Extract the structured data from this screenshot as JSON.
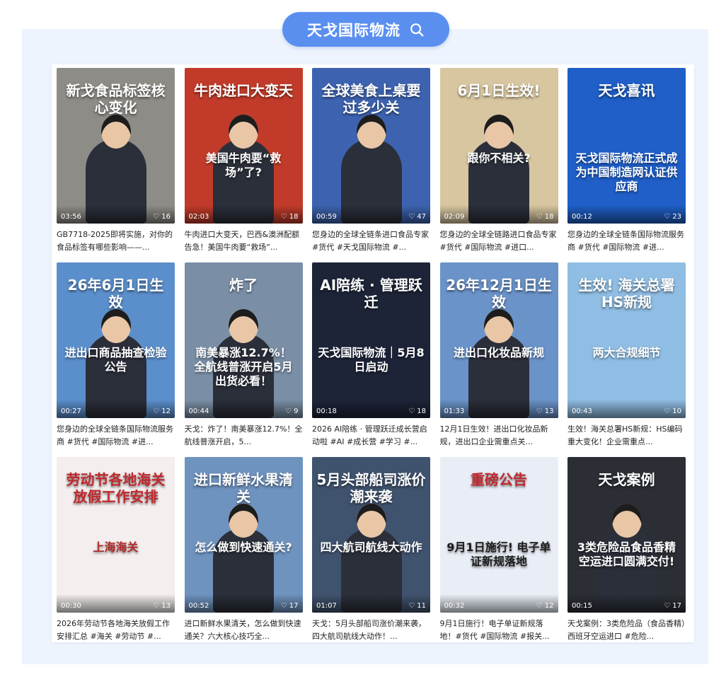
{
  "header": {
    "search_title": "天戈国际物流",
    "search_icon": "search-icon"
  },
  "items": [
    {
      "duration": "03:56",
      "likes": "16",
      "title": "新戈食品标签核心变化",
      "sub": "",
      "caption": "GB7718-2025即将实施，对你的食品标签有哪些影响——...",
      "bg": "#8e8c86"
    },
    {
      "duration": "02:03",
      "likes": "18",
      "title": "牛肉进口大变天",
      "sub": "美国牛肉要“救场”了?",
      "caption": "牛肉进口大变天，巴西&澳洲配额告急！美国牛肉要“救场”...",
      "bg": "#c23b2a"
    },
    {
      "duration": "00:59",
      "likes": "47",
      "title": "全球美食上桌要过多少关",
      "sub": "",
      "caption": "您身边的全球全链条进口食品专家#货代 #天戈国际物流 #...",
      "bg": "#3d63b0"
    },
    {
      "duration": "02:09",
      "likes": "18",
      "title": "6月1日生效!",
      "sub": "跟你不相关?",
      "caption": "您身边的全球全链路进口食品专家#货代 #国际物流 #进口...",
      "bg": "#d8c6a0"
    },
    {
      "duration": "00:12",
      "likes": "23",
      "title": "天戈喜讯",
      "sub": "天戈国际物流正式成为中国制造网认证供应商",
      "caption": "您身边的全球全链条国际物流服务商 #货代 #国际物流 #进...",
      "bg": "#1f5fc7"
    },
    {
      "duration": "00:27",
      "likes": "12",
      "title": "26年6月1日生效",
      "sub": "进出口商品抽查检验公告",
      "caption": "您身边的全球全链条国际物流服务商 #货代 #国际物流 #进...",
      "bg": "#5b8fcc"
    },
    {
      "duration": "00:44",
      "likes": "9",
      "title": "炸了",
      "sub": "南美暴涨12.7%！全航线普涨开启5月出货必看！",
      "caption": "天戈：炸了！南美暴涨12.7%！全航线普涨开启，5...",
      "bg": "#7a8fa6"
    },
    {
      "duration": "00:18",
      "likes": "18",
      "title": "AI陪练 · 管理跃迁",
      "sub": "天戈国际物流｜5月8日启动",
      "caption": "2026 AI陪练 · 管理跃迁成长营启动啦 #AI #成长营 #学习 #...",
      "bg": "#1d2438"
    },
    {
      "duration": "01:33",
      "likes": "13",
      "title": "26年12月1日生效",
      "sub": "进出口化妆品新规",
      "caption": "12月1日生效！进出口化妆品新规，进出口企业需重点关...",
      "bg": "#6a93c9"
    },
    {
      "duration": "00:43",
      "likes": "10",
      "title": "生效! 海关总署HS新规",
      "sub": "两大合规细节",
      "caption": "生效！海关总署HS新规：HS编码重大变化！企业需重点...",
      "bg": "#8fbde3"
    },
    {
      "duration": "00:30",
      "likes": "13",
      "title": "劳动节各地海关放假工作安排",
      "sub": "上海海关",
      "caption": "2026年劳动节各地海关放假工作安排汇总 #海关 #劳动节 #...",
      "bg": "#f4eeee"
    },
    {
      "duration": "00:52",
      "likes": "17",
      "title": "进口新鲜水果清关",
      "sub": "怎么做到快速通关?",
      "caption": "进口新鲜水果清关，怎么做到快速通关？六大核心技巧全...",
      "bg": "#6f93bf"
    },
    {
      "duration": "01:07",
      "likes": "11",
      "title": "5月头部船司涨价潮来袭",
      "sub": "四大航司航线大动作",
      "caption": "天戈：5月头部船司涨价潮来袭，四大航司航线大动作！...",
      "bg": "#40536e"
    },
    {
      "duration": "00:32",
      "likes": "12",
      "title": "重磅公告",
      "sub": "9月1日施行! 电子单证新规落地",
      "caption": "9月1日施行！电子单证新规落地！#货代 #国际物流 #报关...",
      "bg": "#e9eef6"
    },
    {
      "duration": "00:15",
      "likes": "17",
      "title": "天戈案例",
      "sub": "3类危险品食品香精空运进口圆满交付!",
      "caption": "天戈案例：3类危险品（食品香精）西班牙空运进口 #危险...",
      "bg": "#2b2e35"
    }
  ]
}
